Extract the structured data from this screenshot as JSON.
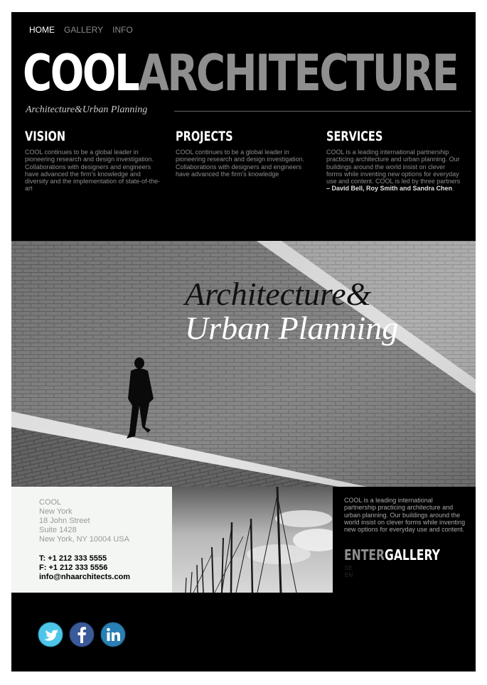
{
  "nav": {
    "items": [
      "HOME",
      "GALLERY",
      "INFO"
    ],
    "active": "HOME"
  },
  "logo": {
    "part1": "COOL",
    "part2": "ARCHITECTURE"
  },
  "tagline": "Architecture&Urban Planning",
  "columns": [
    {
      "heading": "VISION",
      "text": "COOL continues to be a global leader in pioneering research and design investigation. Collaborations with designers and engineers have advanced the firm's knowledge and diversity and the implementation of state-of-the-art"
    },
    {
      "heading": "PROJECTS",
      "text": "COOL continues to be a global leader in pioneering research and design investigation. Collaborations with designers and engineers have advanced the firm's knowledge"
    },
    {
      "heading": "SERVICES",
      "text": "COOL is a leading international partnership practicing architecture and urban planning. Our buildings around the world insist on clever forms while inventing new options for everyday use and content. COOL is led by three partners",
      "partners": "– David Bell, Roy Smith and Sandra Chen",
      "end": "."
    }
  ],
  "hero": {
    "line1": "Architecture&",
    "line2": "Urban Planning"
  },
  "address": {
    "name": "COOL",
    "city": "New York",
    "street": "18 John Street",
    "suite": "Suite 1428",
    "cityzip": "New York, NY 10004 USA",
    "tel": "T: +1 212 333 5555",
    "fax": "F: +1 212 333 5556",
    "email": "info@nhaarchitects.com"
  },
  "right": {
    "text": "COOL is a leading international partnership practicing architecture and urban planning. Our buildings around the world insist on clever forms while inventing new options for everyday use and content.",
    "enter1": "ENTER",
    "enter2": "GALLERY",
    "langs": [
      "DE",
      "EN"
    ]
  },
  "social": [
    "twitter-icon",
    "facebook-icon",
    "linkedin-icon"
  ],
  "colors": {
    "background": "#000000",
    "accentGrey": "#8f8f8f",
    "twitter": "#4ec5e8",
    "facebook": "#3b5a9a",
    "linkedin": "#2a7fb3"
  }
}
